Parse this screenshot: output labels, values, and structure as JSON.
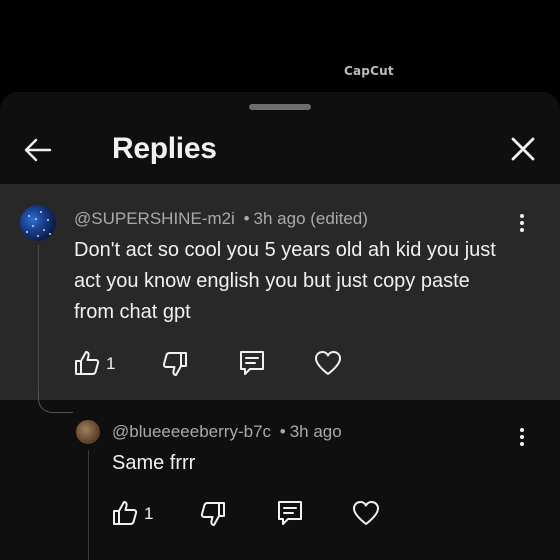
{
  "watermark": "CapCut",
  "header": {
    "title": "Replies"
  },
  "parent_comment": {
    "handle": "@SUPERSHINE-m2i",
    "separator": "•",
    "time": "3h ago (edited)",
    "text": "Don't act so cool you 5 years old ah kid you just act you know english you but just copy paste from chat gpt",
    "like_count": "1"
  },
  "reply_comment": {
    "handle": "@blueeeeeberry-b7c",
    "separator": "•",
    "time": "3h ago",
    "text": "Same frrr",
    "like_count": "1"
  },
  "icons": {
    "back": "arrow-left-icon",
    "close": "close-icon",
    "more": "more-vertical-icon",
    "like": "thumbs-up-icon",
    "dislike": "thumbs-down-icon",
    "reply": "comment-icon",
    "heart": "heart-icon"
  }
}
